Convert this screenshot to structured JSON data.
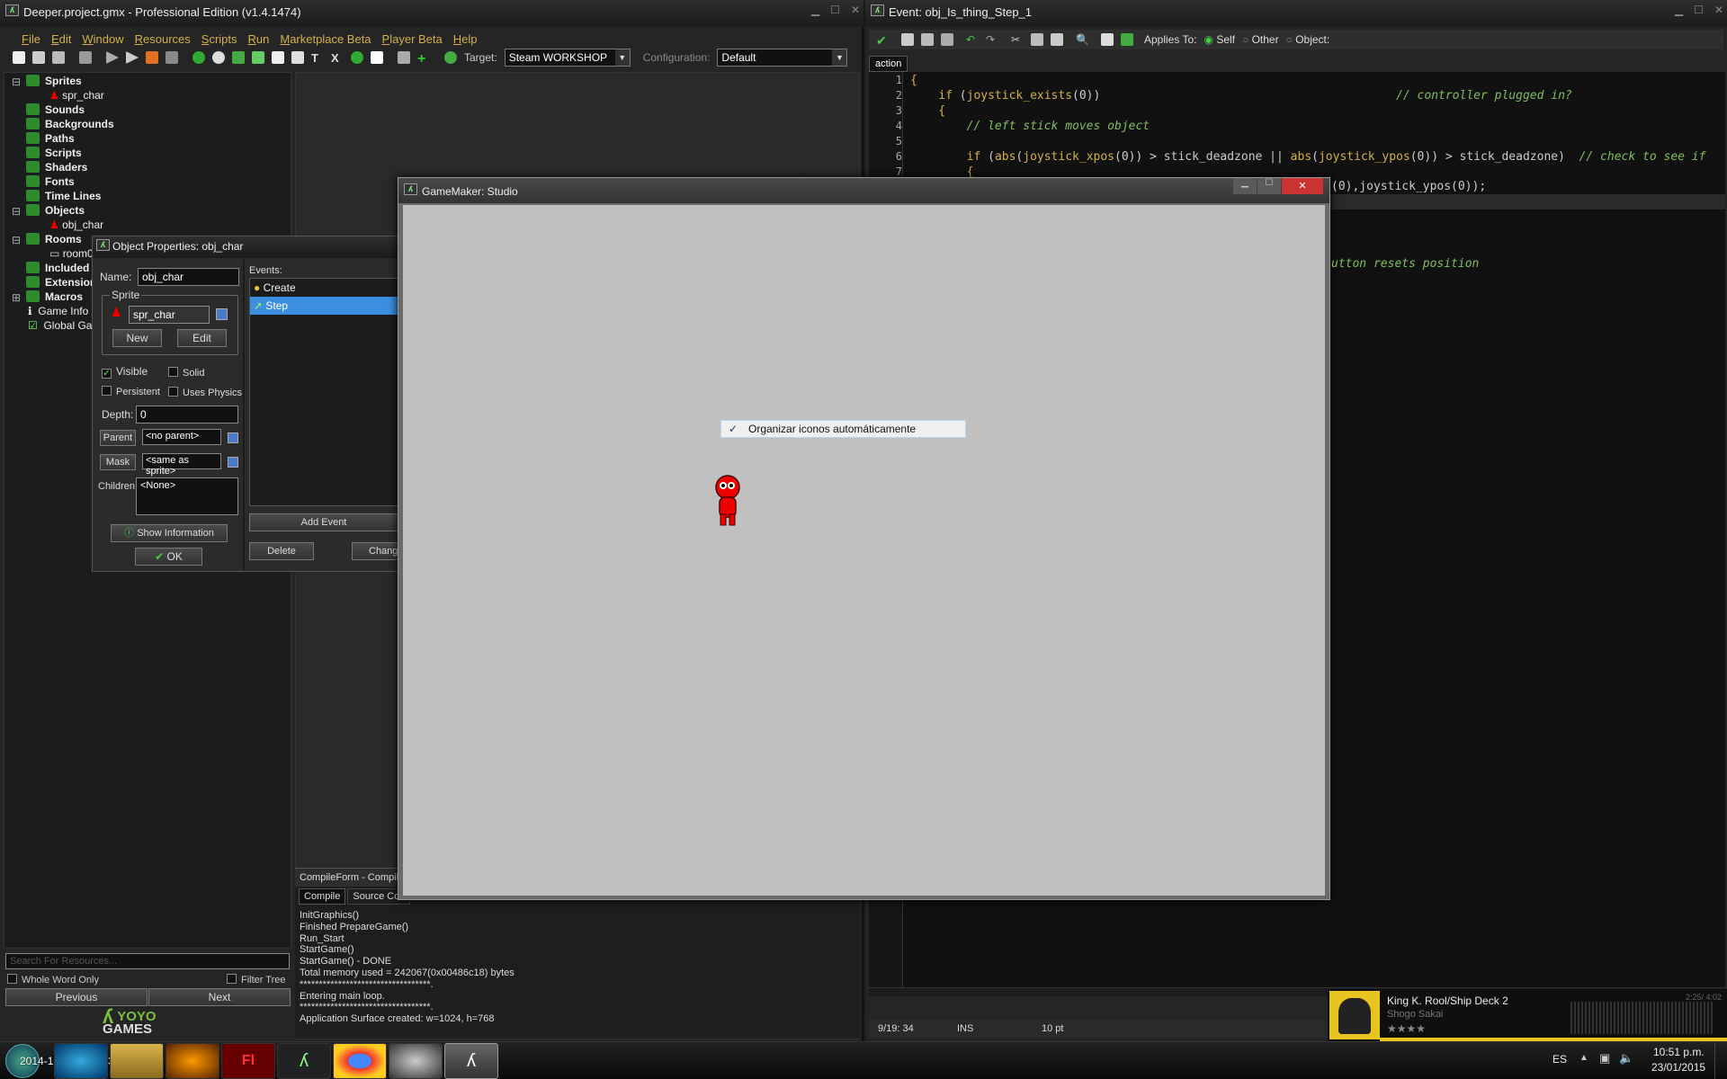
{
  "main_window": {
    "title": "Deeper.project.gmx  -  Professional Edition (v1.4.1474)",
    "menu": [
      "File",
      "Edit",
      "Window",
      "Resources",
      "Scripts",
      "Run",
      "Marketplace Beta",
      "Player Beta",
      "Help"
    ],
    "target_label": "Target:",
    "target_value": "Steam WORKSHOP",
    "config_label": "Configuration:",
    "config_value": "Default"
  },
  "resource_tree": {
    "items": [
      {
        "label": "Sprites",
        "bold": true
      },
      {
        "label": "spr_char",
        "bold": false
      },
      {
        "label": "Sounds",
        "bold": true
      },
      {
        "label": "Backgrounds",
        "bold": true
      },
      {
        "label": "Paths",
        "bold": true
      },
      {
        "label": "Scripts",
        "bold": true
      },
      {
        "label": "Shaders",
        "bold": true
      },
      {
        "label": "Fonts",
        "bold": true
      },
      {
        "label": "Time Lines",
        "bold": true
      },
      {
        "label": "Objects",
        "bold": true
      },
      {
        "label": "obj_char",
        "bold": false
      },
      {
        "label": "Rooms",
        "bold": true
      },
      {
        "label": "room0",
        "bold": false
      },
      {
        "label": "Included",
        "bold": true
      },
      {
        "label": "Extension",
        "bold": true
      },
      {
        "label": "Macros",
        "bold": true
      },
      {
        "label": "Game Info",
        "bold": false
      },
      {
        "label": "Global Gar",
        "bold": false
      }
    ],
    "search_placeholder": "Search For Resources...",
    "whole_word": "Whole Word Only",
    "filter_tree": "Filter Tree",
    "previous": "Previous",
    "next": "Next",
    "logo_top": "YOYO",
    "logo_bottom": "GAMES"
  },
  "object_props": {
    "title": "Object Properties: obj_char",
    "name_label": "Name:",
    "name_value": "obj_char",
    "sprite_group": "Sprite",
    "sprite_value": "spr_char",
    "new_btn": "New",
    "edit_btn": "Edit",
    "visible": "Visible",
    "solid": "Solid",
    "persistent": "Persistent",
    "uses_physics": "Uses Physics",
    "depth_label": "Depth:",
    "depth_value": "0",
    "parent_btn": "Parent",
    "parent_value": "<no parent>",
    "mask_btn": "Mask",
    "mask_value": "<same as sprite>",
    "children_label": "Children:",
    "children_value": "<None>",
    "show_info": "Show Information",
    "ok": "OK",
    "events_label": "Events:",
    "events": [
      "Create",
      "Step"
    ],
    "add_event": "Add Event",
    "delete": "Delete",
    "change": "Chang"
  },
  "compile": {
    "title": "CompileForm - Compile",
    "tabs": [
      "Compile",
      "Source Con"
    ],
    "lines": [
      "InitGraphics()",
      "Finished PrepareGame()",
      "Run_Start",
      "StartGame()",
      "StartGame() - DONE",
      "Total memory used = 242067(0x00486c18) bytes",
      "**********************************.",
      "Entering main loop.",
      "**********************************.",
      "Application Surface created: w=1024, h=768"
    ]
  },
  "code_editor": {
    "title": "Event: obj_Is_thing_Step_1",
    "applies_to": "Applies To:",
    "self": "Self",
    "other": "Other",
    "object": "Object:",
    "tab": "action",
    "line_numbers": [
      "1",
      "2",
      "3",
      "4",
      "5",
      "6",
      "7"
    ],
    "partial_1": "(0),joystick_ypos(0));",
    "partial_2": "utton resets position",
    "status_pos": "9/19:  34",
    "status_mode": "INS",
    "status_size": "10 pt"
  },
  "game_window": {
    "title": "GameMaker: Studio",
    "context_item": "Organizar iconos automáticamente"
  },
  "media_player": {
    "track": "King K. Rool/Ship Deck 2",
    "artist": "Shogo Sakai",
    "time": "2:25/ 4:02"
  },
  "taskbar": {
    "overlay_text": "2014-12-21 20:51:320.bz",
    "lang": "ES",
    "time": "10:51 p.m.",
    "date": "23/01/2015"
  }
}
